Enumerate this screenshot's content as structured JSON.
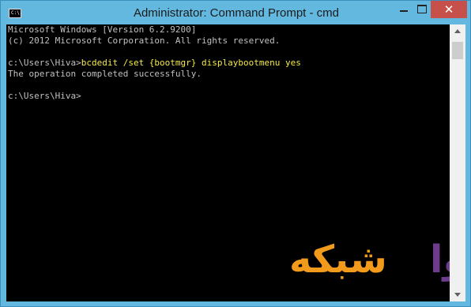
{
  "window": {
    "title": "Administrator: Command Prompt - cmd",
    "icon_name": "command-prompt-icon",
    "icon_glyph": "C:\\.",
    "controls": {
      "minimize": "minimize",
      "maximize": "maximize",
      "close": "✕"
    }
  },
  "console": {
    "lines": [
      {
        "text": "Microsoft Windows [Version 6.2.9200]"
      },
      {
        "text": "(c) 2012 Microsoft Corporation. All rights reserved."
      },
      {
        "text": ""
      },
      {
        "prompt": "c:\\Users\\Hiva>",
        "command": "bcdedit /set {bootmgr} displaybootmenu yes"
      },
      {
        "text": "The operation completed successfully."
      },
      {
        "text": ""
      },
      {
        "prompt": "c:\\Users\\Hiva>"
      }
    ],
    "text_color": "#c0c0c0",
    "command_color": "#f4e94a",
    "background": "#000000"
  },
  "watermark": {
    "word_orange": "شبکه",
    "word_purple": "هیوا",
    "orange": "#f19a1b",
    "purple": "#6d3c8c"
  }
}
